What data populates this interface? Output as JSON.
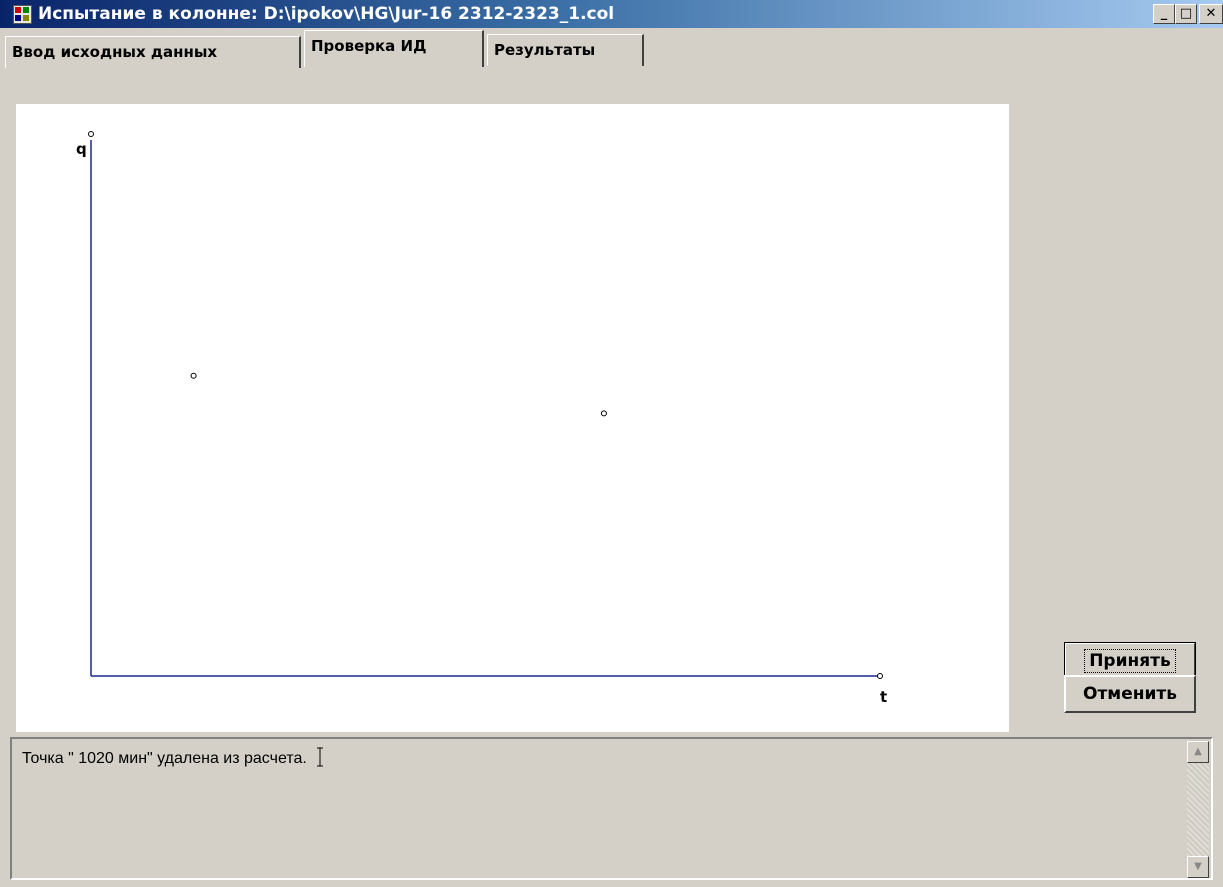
{
  "window": {
    "title": "Испытание в колонне: D:\\ipokov\\HG\\Jur-16 2312-2323_1.col",
    "controls": {
      "minimize": "_",
      "maximize": "□",
      "close": "✕"
    }
  },
  "tabs": [
    {
      "label": "Ввод исходных данных",
      "active": false
    },
    {
      "label": "Проверка ИД",
      "active": true
    },
    {
      "label": "Результаты",
      "active": false
    }
  ],
  "chart_data": {
    "type": "scatter",
    "xlabel": "t",
    "ylabel": "q",
    "points": [
      {
        "x": 0.13,
        "y": 0.56
      },
      {
        "x": 0.65,
        "y": 0.49
      }
    ],
    "xlim": [
      0,
      1
    ],
    "ylim": [
      0,
      1
    ],
    "grid": false,
    "axis_color": "#1c2a8a"
  },
  "buttons": {
    "accept": "Принять",
    "cancel": "Отменить"
  },
  "log": {
    "message": "Точка \" 1020 мин\" удалена из расчета."
  }
}
